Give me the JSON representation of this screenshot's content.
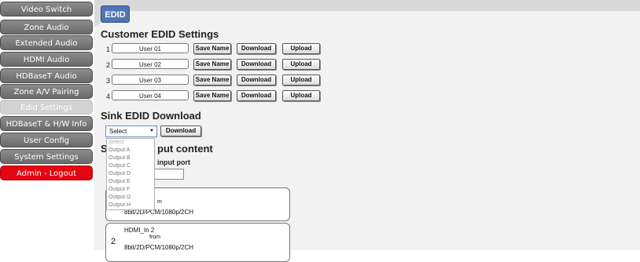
{
  "sidebar": {
    "items": [
      {
        "label": "Video Switch",
        "state": "normal"
      },
      {
        "label": "Zone Audio",
        "state": "normal"
      },
      {
        "label": "Extended Audio",
        "state": "normal"
      },
      {
        "label": "HDMI Audio",
        "state": "normal"
      },
      {
        "label": "HDBaseT Audio",
        "state": "normal"
      },
      {
        "label": "Zone A/V Pairing",
        "state": "normal"
      },
      {
        "label": "Edid Settings",
        "state": "selected"
      },
      {
        "label": "HDBaseT & H/W Info",
        "state": "normal"
      },
      {
        "label": "User Config",
        "state": "normal"
      },
      {
        "label": "System Settings",
        "state": "normal"
      },
      {
        "label": "Admin - Logout",
        "state": "logout"
      }
    ]
  },
  "tab": {
    "label": "EDID"
  },
  "customer_edid": {
    "heading": "Customer EDID Settings",
    "rows": [
      {
        "num": "1",
        "name": "User 01"
      },
      {
        "num": "2",
        "name": "User 02"
      },
      {
        "num": "3",
        "name": "User 03"
      },
      {
        "num": "4",
        "name": "User 04"
      }
    ],
    "save_label": "Save Name",
    "download_label": "Download",
    "upload_label": "Upload"
  },
  "sink_edid": {
    "heading": "Sink EDID Download",
    "selected": "Select",
    "download_label": "Download",
    "options": [
      "Select",
      "Output A",
      "Output B",
      "Output C",
      "Output D",
      "Output E",
      "Output F",
      "Output G",
      "Output H"
    ]
  },
  "input_content": {
    "heading_start": "S",
    "heading_end": "put content",
    "port_label": "input port",
    "cards": [
      {
        "num": "",
        "title": "",
        "from_text": "m",
        "format": "8bit/2D/PCM/1080p/2CH"
      },
      {
        "num": "2",
        "title": "HDMI_In 2",
        "from_text": "from",
        "format": "8bit/2D/PCM/1080p/2CH"
      }
    ]
  },
  "colors": {
    "sidebar_item": "#7a7a7a",
    "sidebar_selected": "#d2d2d2",
    "logout": "#e30613",
    "tab": "#5175b4",
    "panel": "#f2f2f2"
  }
}
